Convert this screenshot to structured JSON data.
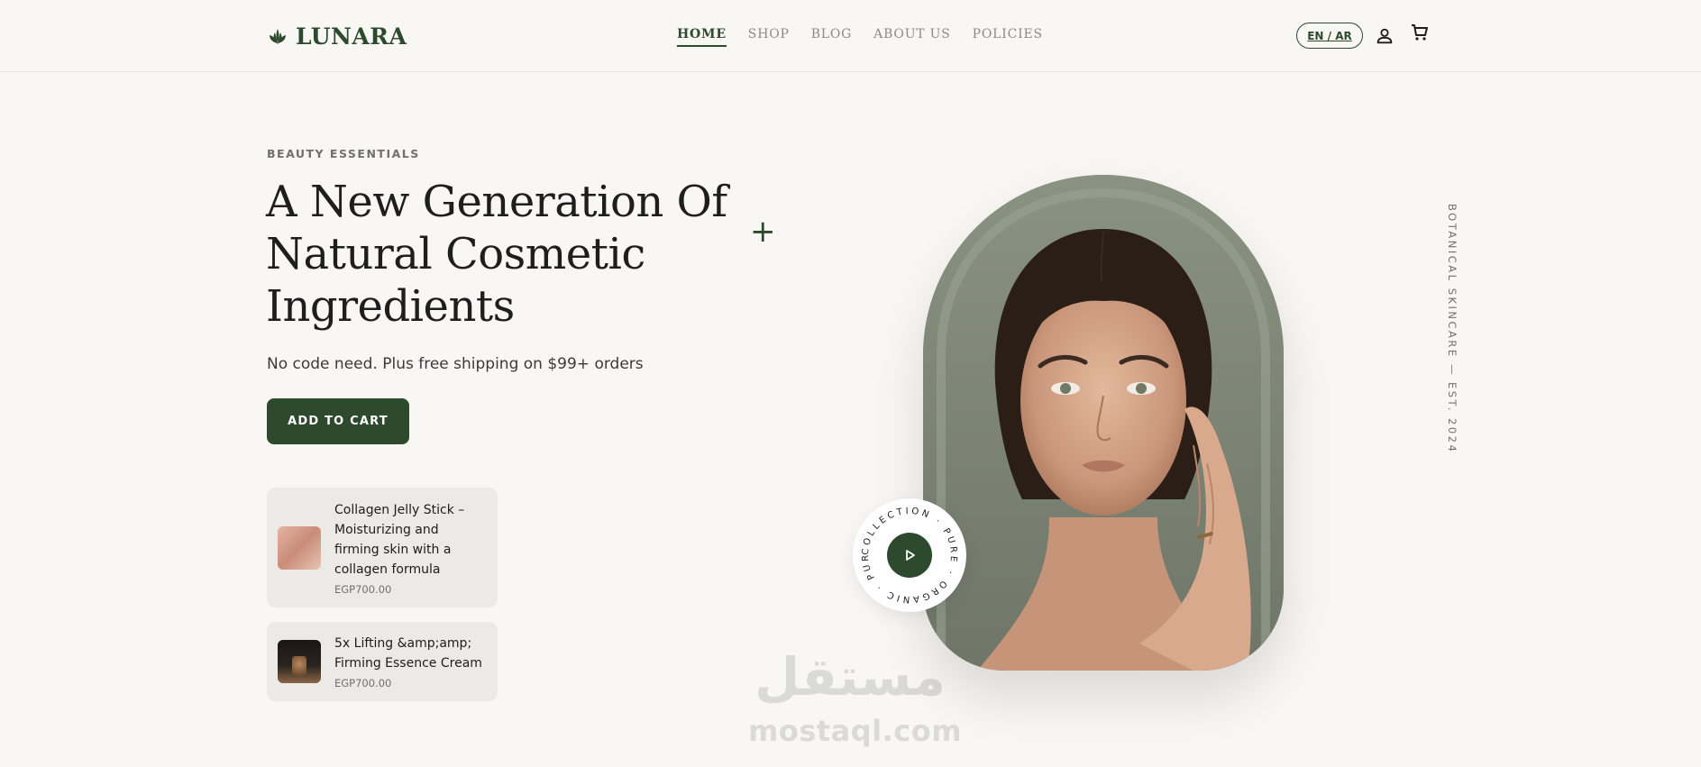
{
  "header": {
    "brand": "LUNARA",
    "nav": [
      "HOME",
      "SHOP",
      "BLOG",
      "ABOUT US",
      "POLICIES"
    ],
    "active_nav": "HOME",
    "lang_label": "EN / AR"
  },
  "hero": {
    "eyebrow": "BEAUTY ESSENTIALS",
    "headline_lines": [
      "A New Generation Of",
      "Natural Cosmetic",
      "Ingredients"
    ],
    "subline": "No code need. Plus free shipping on $99+ orders",
    "cta_label": "ADD TO CART",
    "plus_symbol": "+",
    "vertical_label": "BOTANICAL SKINCARE — EST. 2024",
    "badge_ring_text": "COLLECTION · PURE · ORGANIC · PURE"
  },
  "products": [
    {
      "title": "Collagen Jelly Stick – Moisturizing and firming skin with a collagen formula",
      "price": "EGP700.00"
    },
    {
      "title": "5x Lifting &amp;amp; Firming Essence Cream",
      "price": "EGP700.00"
    }
  ],
  "watermark": {
    "arabic": "مستقل",
    "latin": "mostaql.com"
  },
  "colors": {
    "accent": "#2d4a2e",
    "background": "#f8f7f4",
    "card": "#ebeae7",
    "sage": "#858c7d"
  }
}
